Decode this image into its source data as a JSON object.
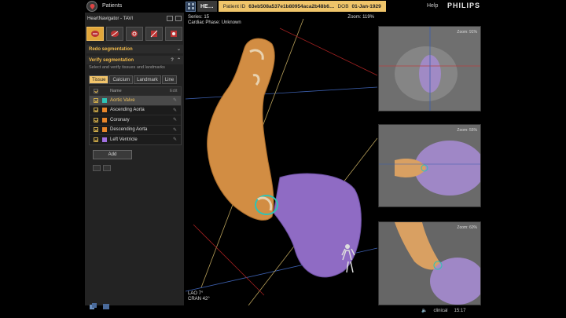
{
  "header": {
    "patients_label": "Patients",
    "tab_label": "HE…",
    "patient_id_label": "Patient ID",
    "patient_id": "63eb508a537e1b80954aca2b48b6…",
    "dob_label": "DOB",
    "dob": "01-Jan-1929",
    "help_label": "Help",
    "brand": "PHILIPS"
  },
  "left_panel": {
    "app_title": "HeartNavigator - TAVI",
    "workflow_icons": [
      "segmentation-icon",
      "aorta-icon",
      "valve-icon",
      "measure-icon",
      "plan-icon"
    ],
    "redo_section": "Redo segmentation",
    "verify_section": "Verify segmentation",
    "hint": "Select and verify tissues and landmarks",
    "tabs": [
      "Tissue",
      "Calcium",
      "Landmark",
      "Line"
    ],
    "active_tab": "Tissue",
    "table_headers": {
      "name": "Name",
      "edit": "Edit"
    },
    "tissues": [
      {
        "name": "Aortic Valve",
        "color": "#2ec4b6",
        "selected": true
      },
      {
        "name": "Ascending Aorta",
        "color": "#e8862a",
        "selected": false
      },
      {
        "name": "Coronary",
        "color": "#e8862a",
        "selected": false
      },
      {
        "name": "Descending Aorta",
        "color": "#e8862a",
        "selected": false
      },
      {
        "name": "Left Ventricle",
        "color": "#a070e0",
        "selected": false
      }
    ],
    "add_label": "Add"
  },
  "viewport": {
    "series": "Series: 15",
    "phase": "Cardiac Phase: Unknown",
    "zoom": "Zoom: 119%",
    "lao": "LAO  7°",
    "cran": "CRAN  42°"
  },
  "side_views": [
    {
      "zoom": "Zoom: 91%"
    },
    {
      "zoom": "Zoom: 55%"
    },
    {
      "zoom": "Zoom: 60%"
    }
  ],
  "statusbar": {
    "mode": "clinical",
    "time": "15:17"
  },
  "colors": {
    "accent": "#f0b94a",
    "aorta": "#d9913f",
    "ventricle": "#9a74cf"
  }
}
